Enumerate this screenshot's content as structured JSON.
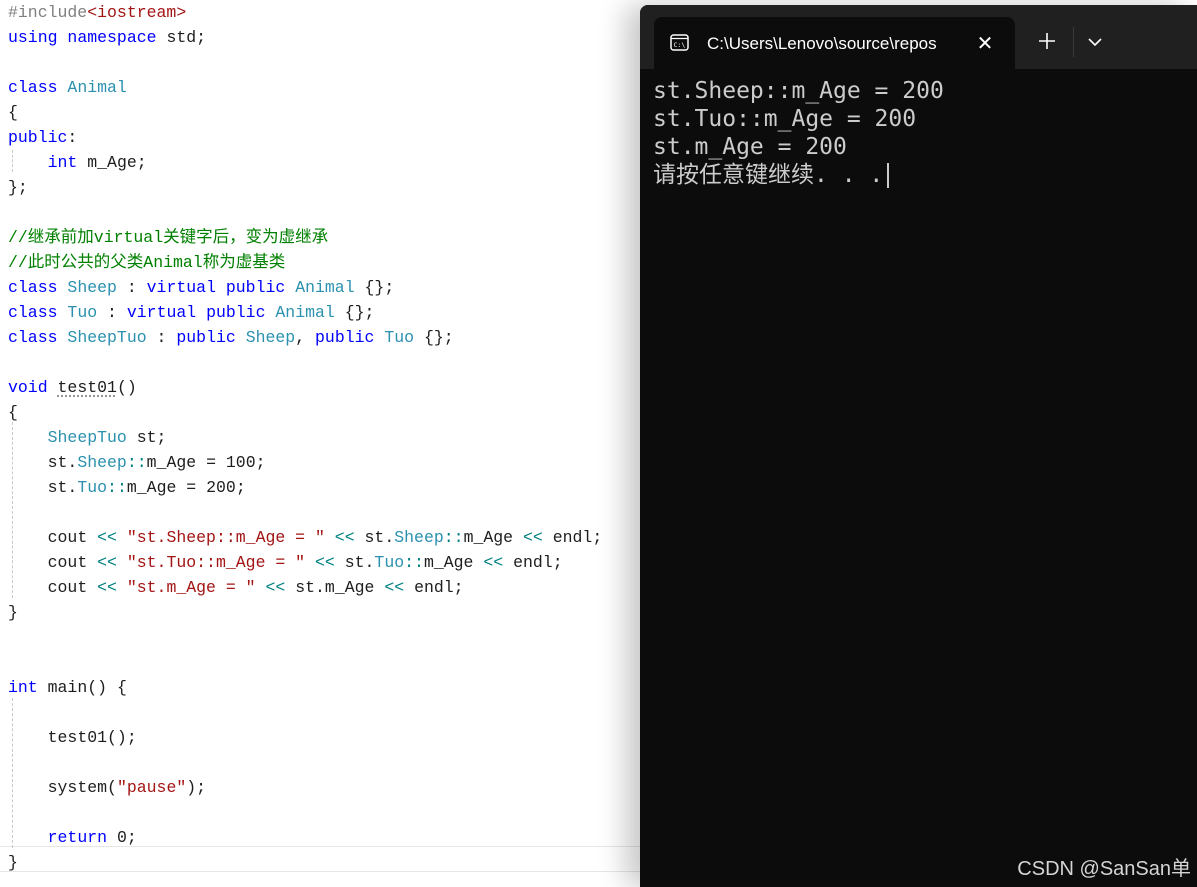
{
  "editor": {
    "lines": [
      "#include<iostream>",
      "using namespace std;",
      "",
      "class Animal",
      "{",
      "public:",
      "    int m_Age;",
      "};",
      "",
      "//继承前加virtual关键字后，变为虚继承",
      "//此时公共的父类Animal称为虚基类",
      "class Sheep : virtual public Animal {};",
      "class Tuo : virtual public Animal {};",
      "class SheepTuo : public Sheep, public Tuo {};",
      "",
      "void test01()",
      "{",
      "    SheepTuo st;",
      "    st.Sheep::m_Age = 100;",
      "    st.Tuo::m_Age = 200;",
      "",
      "    cout << \"st.Sheep::m_Age = \" << st.Sheep::m_Age << endl;",
      "    cout << \"st.Tuo::m_Age = \" << st.Tuo::m_Age << endl;",
      "    cout << \"st.m_Age = \" << st.m_Age << endl;",
      "}",
      "",
      "",
      "int main() {",
      "",
      "    test01();",
      "",
      "    system(\"pause\");",
      "",
      "    return 0;",
      "}"
    ],
    "colors": {
      "keyword": "#0000ff",
      "type": "#2b91af",
      "string": "#a31515",
      "comment": "#008000",
      "preprocessor": "#808080"
    }
  },
  "terminal": {
    "tab_title": "C:\\Users\\Lenovo\\source\\repos",
    "tab_icon": "terminal-icon",
    "close_icon": "close-icon",
    "new_tab_icon": "plus-icon",
    "dropdown_icon": "chevron-down-icon",
    "output": [
      "st.Sheep::m_Age = 200",
      "st.Tuo::m_Age = 200",
      "st.m_Age = 200",
      "请按任意键继续. . ."
    ],
    "background": "#0c0c0c",
    "foreground": "#cccccc"
  },
  "watermark": "CSDN @SanSan单"
}
